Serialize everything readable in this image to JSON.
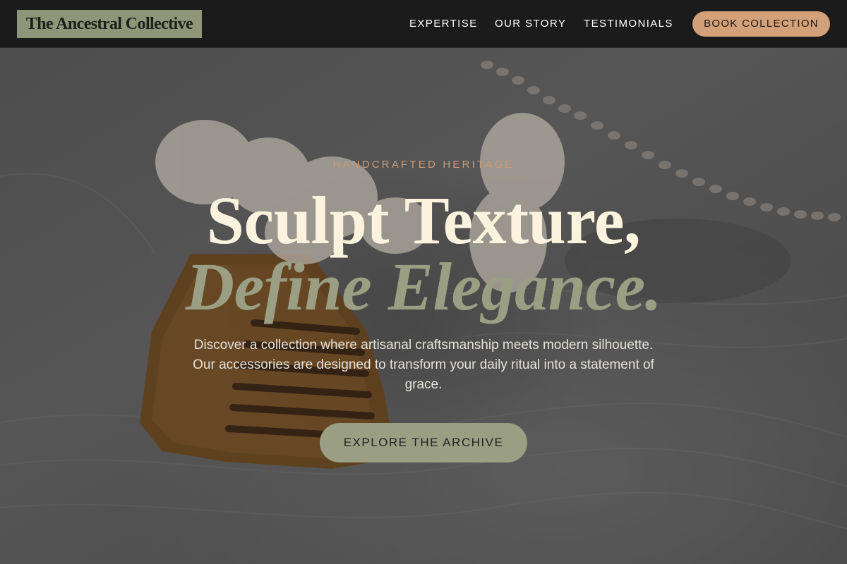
{
  "header": {
    "logo_text": "The Ancestral Collective",
    "nav": [
      {
        "label": "EXPERTISE"
      },
      {
        "label": "OUR STORY"
      },
      {
        "label": "TESTIMONIALS"
      }
    ],
    "book_button": "BOOK COLLECTION"
  },
  "hero": {
    "eyebrow": "HANDCRAFTED HERITAGE",
    "headline_line1": "Sculpt Texture,",
    "headline_line2": "Define Elegance.",
    "description": "Discover a collection where artisanal craftsmanship meets modern silhouette. Our accessories are designed to transform your daily ritual into a statement of grace.",
    "cta_label": "EXPLORE THE ARCHIVE",
    "background_image": "wooden-comb-and-hair-accessories-on-knit-fabric"
  },
  "colors": {
    "header_bg": "#1b1b1b",
    "logo_bg": "#8f9579",
    "accent_tan": "#d2a079",
    "eyebrow": "#c99a78",
    "headline_cream": "#fbf3de",
    "headline_sage": "#9a9f84",
    "cta_bg": "#9a9f84"
  }
}
